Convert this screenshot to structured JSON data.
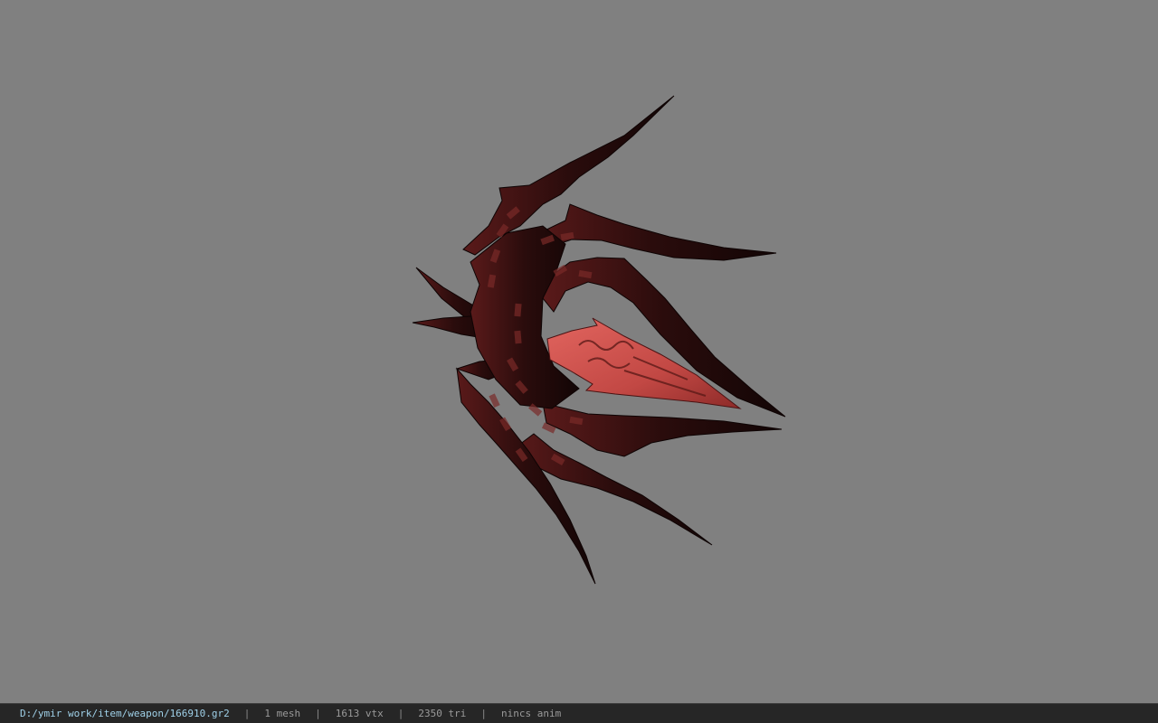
{
  "viewport": {
    "background_color": "#808080",
    "model_colors": {
      "dark": "#1e0b0b",
      "mid": "#6e2222",
      "accent": "#d9534f"
    }
  },
  "status": {
    "file_path": "D:/ymir work/item/weapon/166910.gr2",
    "separator": "|",
    "mesh_count": "1 mesh",
    "vertex_count": "1613 vtx",
    "triangle_count": "2350 tri",
    "anim_status": "nincs anim"
  }
}
